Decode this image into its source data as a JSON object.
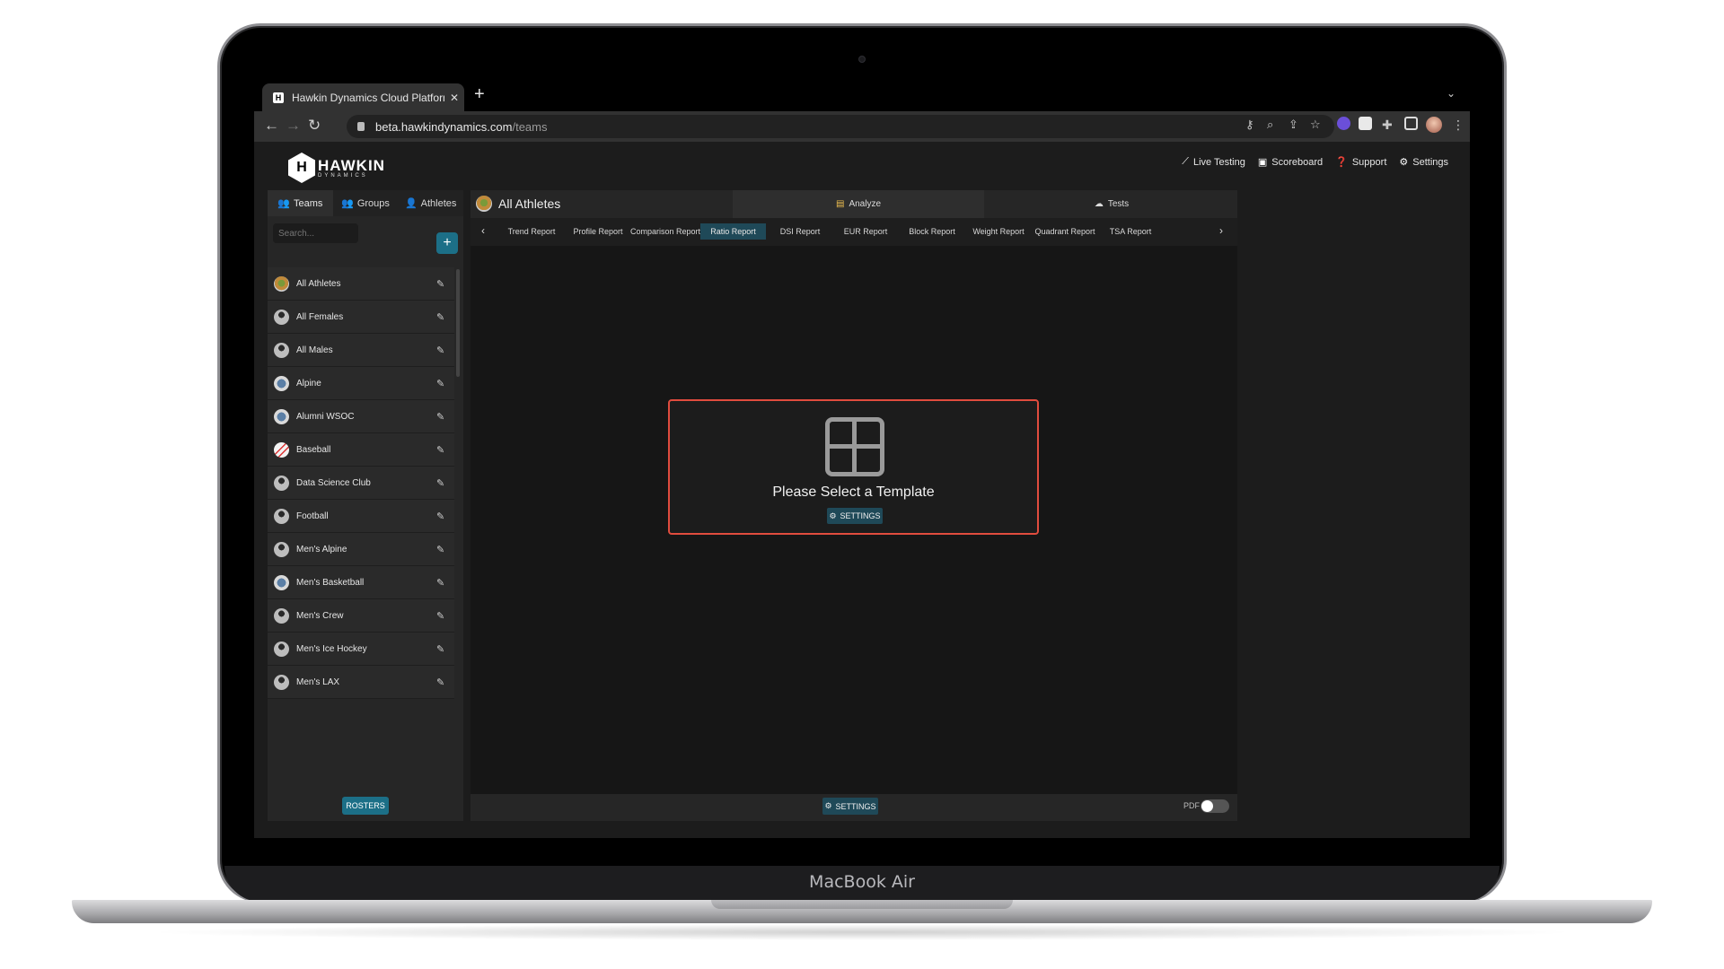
{
  "device": {
    "brand_label": "MacBook Air"
  },
  "browser": {
    "tab_title": "Hawkin Dynamics Cloud Platform",
    "favicon_letter": "H",
    "url_host": "beta.hawkindynamics.com",
    "url_path": "/teams"
  },
  "app": {
    "logo": {
      "letter": "H",
      "name": "HAWKIN",
      "sub": "DYNAMICS"
    },
    "topnav": [
      {
        "label": "Live Testing",
        "icon": "chart-line-icon"
      },
      {
        "label": "Scoreboard",
        "icon": "scoreboard-icon"
      },
      {
        "label": "Support",
        "icon": "help-icon"
      },
      {
        "label": "Settings",
        "icon": "gear-icon"
      }
    ]
  },
  "left_panel": {
    "tabs": [
      {
        "label": "Teams",
        "active": true
      },
      {
        "label": "Groups",
        "active": false
      },
      {
        "label": "Athletes",
        "active": false
      }
    ],
    "search_placeholder": "Search...",
    "items": [
      {
        "name": "All Athletes",
        "avatar": "team-logo"
      },
      {
        "name": "All Females",
        "avatar": "person"
      },
      {
        "name": "All Males",
        "avatar": "person"
      },
      {
        "name": "Alpine",
        "avatar": "team-logo"
      },
      {
        "name": "Alumni WSOC",
        "avatar": "team-logo"
      },
      {
        "name": "Baseball",
        "avatar": "baseball"
      },
      {
        "name": "Data Science Club",
        "avatar": "person"
      },
      {
        "name": "Football",
        "avatar": "person"
      },
      {
        "name": "Men's Alpine",
        "avatar": "person"
      },
      {
        "name": "Men's Basketball",
        "avatar": "team-logo"
      },
      {
        "name": "Men's Crew",
        "avatar": "person"
      },
      {
        "name": "Men's Ice Hockey",
        "avatar": "person"
      },
      {
        "name": "Men's LAX",
        "avatar": "person"
      }
    ],
    "rosters_label": "ROSTERS"
  },
  "main": {
    "title": "All Athletes",
    "modes": [
      {
        "label": "Analyze",
        "active": true
      },
      {
        "label": "Tests",
        "active": false
      }
    ],
    "reports": [
      {
        "label": "Trend Report",
        "active": false
      },
      {
        "label": "Profile Report",
        "active": false
      },
      {
        "label": "Comparison Report",
        "active": false
      },
      {
        "label": "Ratio Report",
        "active": true
      },
      {
        "label": "DSI Report",
        "active": false
      },
      {
        "label": "EUR Report",
        "active": false
      },
      {
        "label": "Block Report",
        "active": false
      },
      {
        "label": "Weight Report",
        "active": false
      },
      {
        "label": "Quadrant Report",
        "active": false
      },
      {
        "label": "TSA Report",
        "active": false
      }
    ],
    "template_prompt": "Please Select a Template",
    "template_settings_label": "SETTINGS",
    "footer_settings_label": "SETTINGS",
    "pdf_label": "PDF",
    "pdf_enabled": false
  },
  "colors": {
    "accent": "#1c6f87",
    "active_report": "#1f4958",
    "highlight_border": "#e04c3e"
  }
}
